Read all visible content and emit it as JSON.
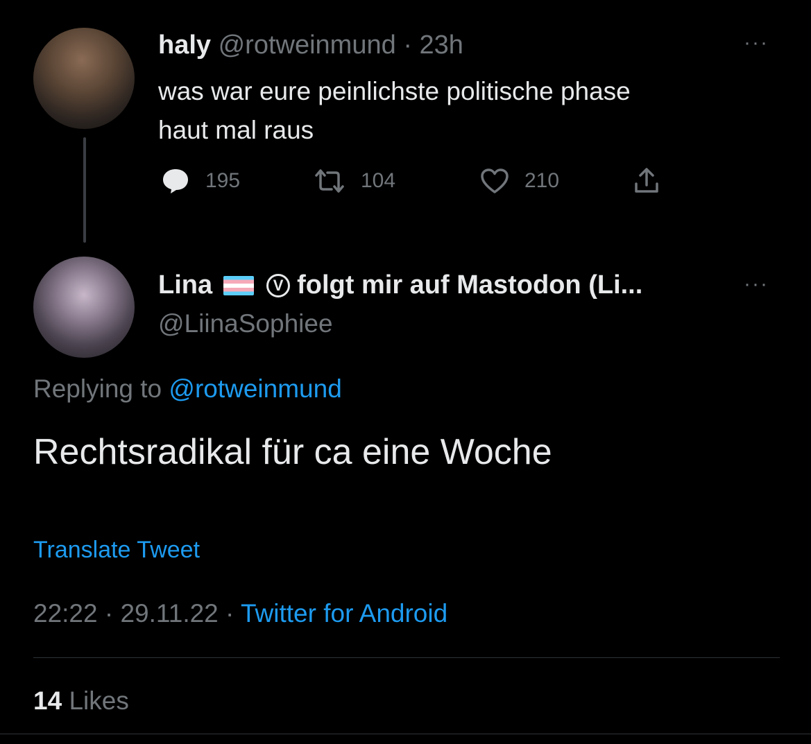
{
  "parent_tweet": {
    "display_name": "haly",
    "handle": "@rotweinmund",
    "separator": "·",
    "time": "23h",
    "text_line1": "was war eure peinlichste politische phase",
    "text_line2": "haut mal raus",
    "reply_count": "195",
    "retweet_count": "104",
    "like_count": "210",
    "more_label": "···"
  },
  "reply_tweet": {
    "display_name": "Lina",
    "v_badge": "V",
    "name_suffix": "folgt mir auf Mastodon (Li...",
    "handle": "@LiinaSophiee",
    "more_label": "···",
    "replying_prefix": "Replying to",
    "replying_handle": "@rotweinmund",
    "text": "Rechtsradikal für ca eine Woche",
    "translate_label": "Translate Tweet",
    "time": "22:22",
    "date": "29.11.22",
    "separator": "·",
    "source": "Twitter for Android",
    "likes_count": "14",
    "likes_label": "Likes"
  },
  "colors": {
    "background": "#000000",
    "text_primary": "#e7e9ea",
    "text_muted": "#71767b",
    "link": "#1d9bf0"
  },
  "icons": {
    "reply": "speech-bubble-icon",
    "retweet": "retweet-icon",
    "like": "heart-icon",
    "share": "share-icon",
    "flag": "trans-flag-icon",
    "more": "more-dots-icon"
  }
}
